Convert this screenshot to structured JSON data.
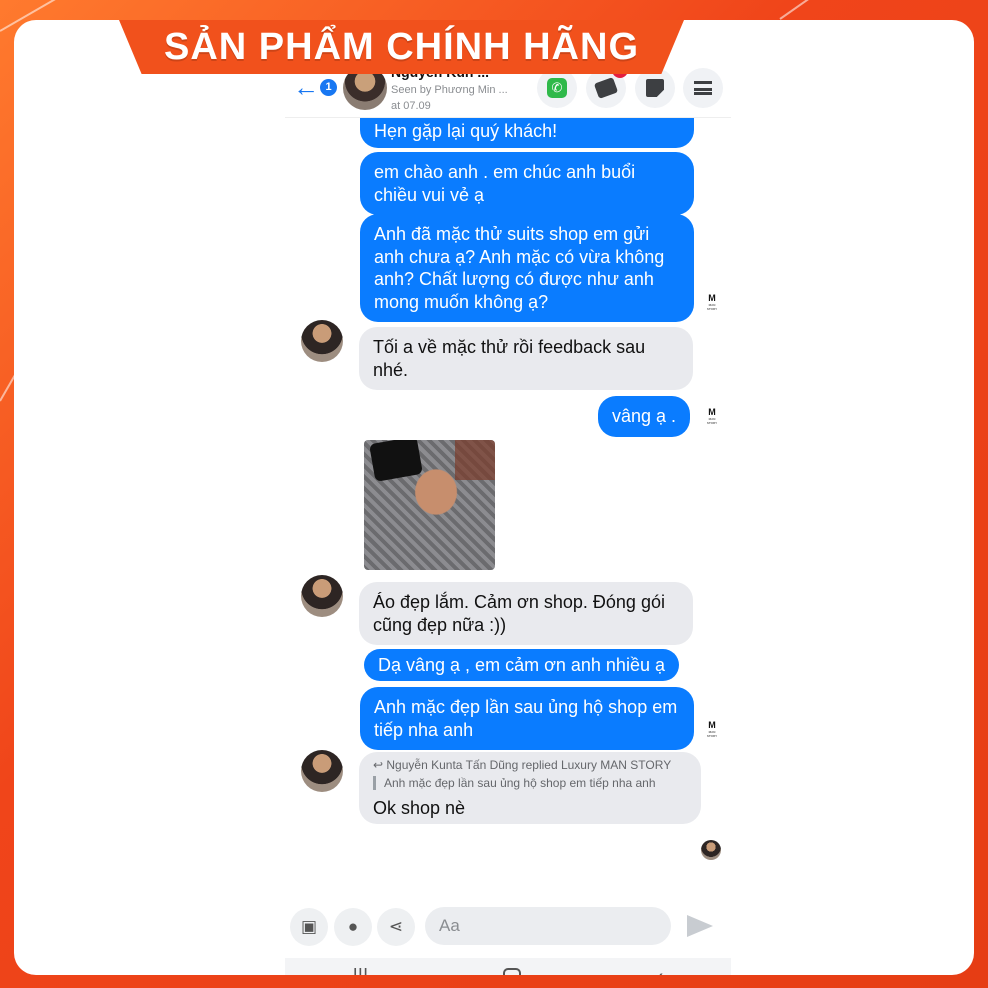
{
  "banner": {
    "title": "SẢN PHẨM CHÍNH HÃNG"
  },
  "header": {
    "back_icon": "←",
    "back_badge": "1",
    "contact_name": "Nguyễn Kun ...",
    "seen_text": "Seen by Phương Min ...",
    "seen_time": "at 07.09",
    "tags_badge": "8"
  },
  "messages": [
    {
      "dir": "out",
      "text": "Hẹn gặp lại quý khách!"
    },
    {
      "dir": "out",
      "text": "em chào anh . em chúc anh buổi chiều vui vẻ ạ"
    },
    {
      "dir": "out",
      "text": "Anh đã mặc thử suits shop em gửi anh chưa ạ? Anh mặc có vừa không anh? Chất lượng có được như anh mong muốn không ạ?"
    },
    {
      "dir": "in",
      "text": "Tối a về mặc thử rồi feedback sau nhé."
    },
    {
      "dir": "out",
      "text": "vâng ạ ."
    },
    {
      "dir": "in",
      "text": "Áo đẹp lắm. Cảm ơn shop. Đóng gói cũng đẹp nữa :))"
    },
    {
      "dir": "out",
      "text": "Dạ vâng ạ , em cảm ơn anh nhiều ạ"
    },
    {
      "dir": "out",
      "text": "Anh mặc đẹp lần sau ủng hộ shop em tiếp nha anh"
    }
  ],
  "reply": {
    "head": "Nguyễn Kunta Tấn Dũng replied Luxury MAN STORY",
    "quote": "Anh mặc đẹp lần sau ủng hộ shop em tiếp nha anh",
    "text": "Ok shop nè"
  },
  "brand_mark": {
    "letter": "M",
    "sub": "MAN STORY"
  },
  "composer": {
    "placeholder": "Aa"
  },
  "colors": {
    "outgoing": "#0a7cff",
    "incoming": "#e9eaee",
    "banner": "#f1511c",
    "accent": "#1877f2"
  },
  "icons": [
    "back-arrow-icon",
    "phone-icon",
    "tag-icon",
    "note-icon",
    "menu-icon",
    "image-icon",
    "chat-bubbles-icon",
    "share-icon",
    "send-icon",
    "recents-icon",
    "home-icon",
    "back-chevron-icon"
  ]
}
